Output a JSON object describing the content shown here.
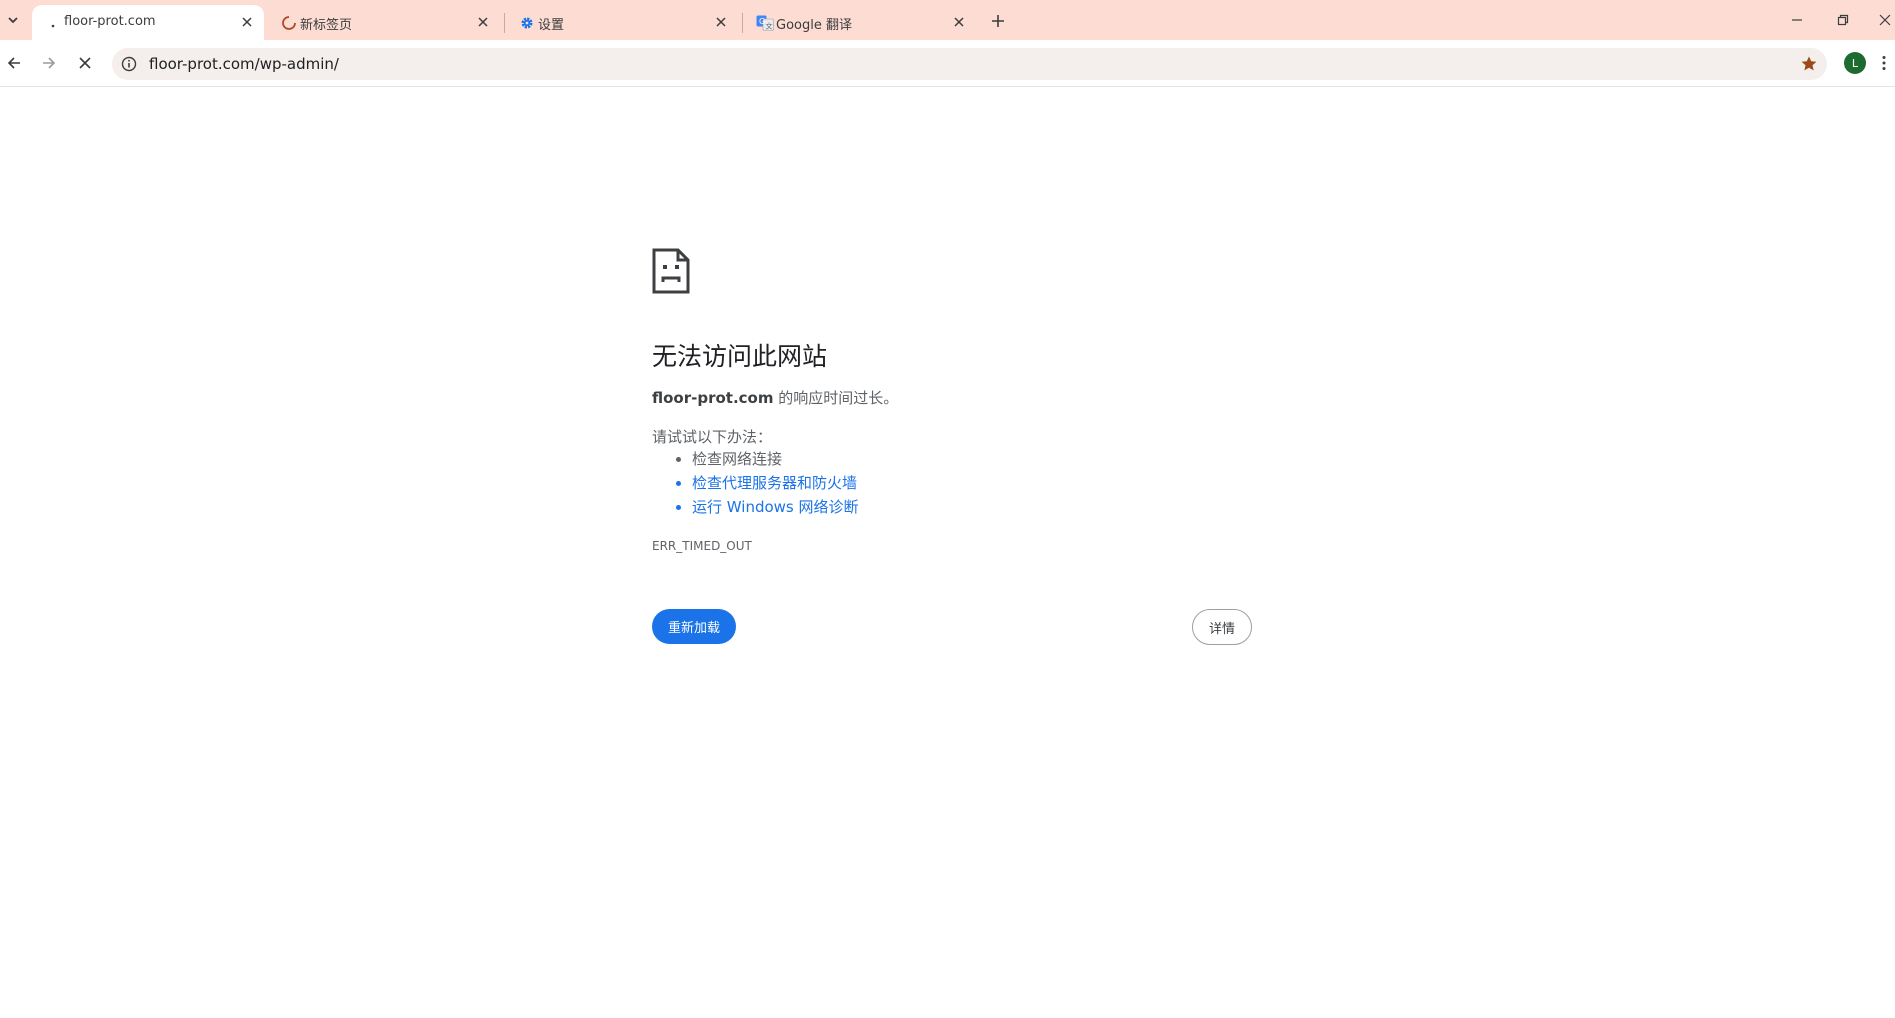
{
  "tabs": [
    {
      "title": "floor-prot.com",
      "favicon": "loading-dot-icon",
      "active": true
    },
    {
      "title": "新标签页",
      "favicon": "loading-spinner-icon",
      "active": false
    },
    {
      "title": "设置",
      "favicon": "gear-icon",
      "active": false
    },
    {
      "title": "Google 翻译",
      "favicon": "google-translate-icon",
      "active": false
    }
  ],
  "toolbar": {
    "url": "floor-prot.com/wp-admin/",
    "avatar_letter": "L"
  },
  "error": {
    "heading": "无法访问此网站",
    "host": "floor-prot.com",
    "summary_suffix": " 的响应时间过长。",
    "try_label": "请试试以下办法：",
    "suggestions": [
      {
        "text": "检查网络连接",
        "link": false
      },
      {
        "text": "检查代理服务器和防火墙",
        "link": true
      },
      {
        "text": "运行 Windows 网络诊断",
        "link": true
      }
    ],
    "code": "ERR_TIMED_OUT",
    "reload_label": "重新加载",
    "details_label": "详情"
  },
  "colors": {
    "tabstrip": "#fcdcd3",
    "omnibox": "#f4eeec",
    "accent": "#1a73e8",
    "star": "#9c4a1a",
    "avatar": "#1e6b2f"
  }
}
